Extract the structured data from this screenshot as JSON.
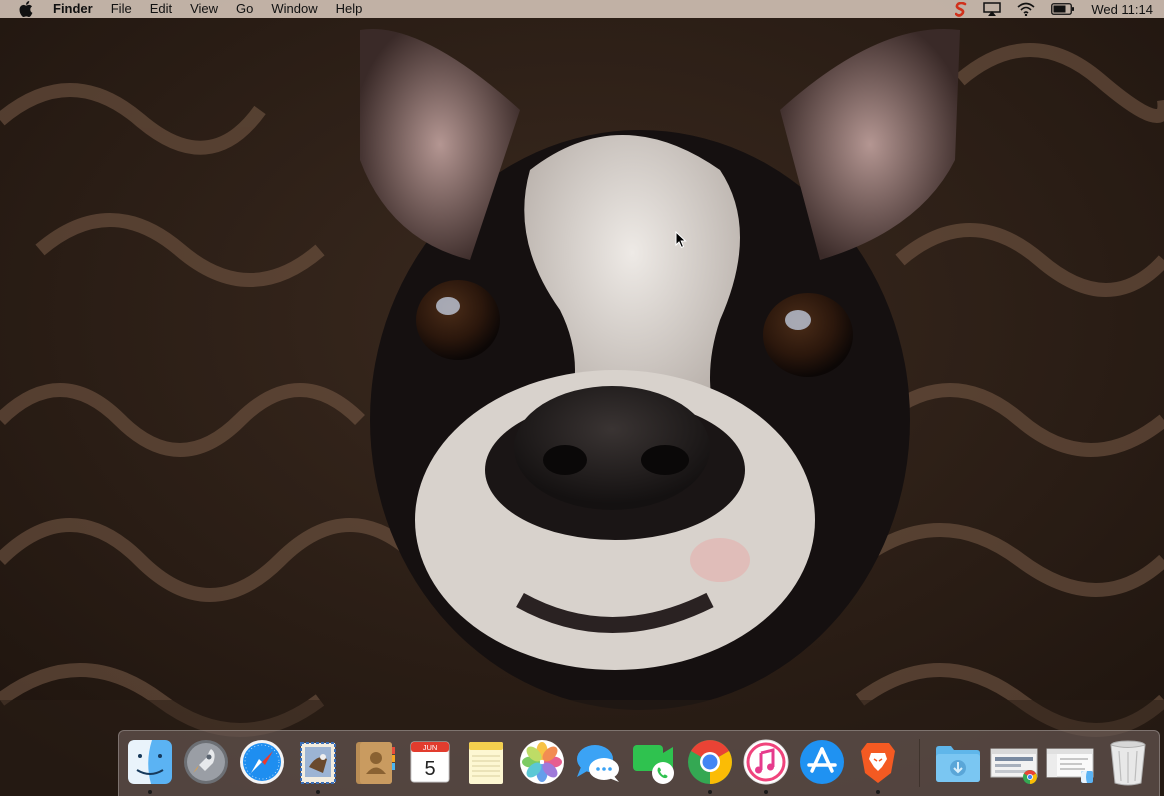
{
  "menubar": {
    "app_name": "Finder",
    "menus": [
      "File",
      "Edit",
      "View",
      "Go",
      "Window",
      "Help"
    ],
    "clock": "Wed 11:14",
    "status_icons": [
      "skitch-icon",
      "airplay-icon",
      "wifi-icon",
      "battery-icon"
    ]
  },
  "dock": {
    "apps": [
      {
        "name": "Finder",
        "icon": "finder-icon",
        "running": true
      },
      {
        "name": "Launchpad",
        "icon": "launchpad-icon",
        "running": false
      },
      {
        "name": "Safari",
        "icon": "safari-icon",
        "running": false
      },
      {
        "name": "Mail",
        "icon": "mail-icon",
        "running": true
      },
      {
        "name": "Contacts",
        "icon": "contacts-icon",
        "running": false
      },
      {
        "name": "Calendar",
        "icon": "calendar-icon",
        "running": false,
        "month": "JUN",
        "day": "5"
      },
      {
        "name": "Notes",
        "icon": "notes-icon",
        "running": false
      },
      {
        "name": "Photos",
        "icon": "photos-icon",
        "running": false
      },
      {
        "name": "Messages",
        "icon": "messages-icon",
        "running": false
      },
      {
        "name": "FaceTime",
        "icon": "facetime-icon",
        "running": false
      },
      {
        "name": "Chrome",
        "icon": "chrome-icon",
        "running": true
      },
      {
        "name": "iTunes",
        "icon": "itunes-icon",
        "running": true
      },
      {
        "name": "App Store",
        "icon": "app-store-icon",
        "running": false
      },
      {
        "name": "Brave",
        "icon": "brave-icon",
        "running": true
      }
    ],
    "others": [
      {
        "name": "Downloads",
        "icon": "downloads-folder-icon"
      },
      {
        "name": "Chrome window",
        "icon": "minimized-chrome-window-icon"
      },
      {
        "name": "Finder window",
        "icon": "minimized-finder-window-icon"
      },
      {
        "name": "Trash",
        "icon": "trash-icon"
      }
    ]
  },
  "colors": {
    "menubar": "#d6c6ba",
    "dock": "#786864"
  }
}
